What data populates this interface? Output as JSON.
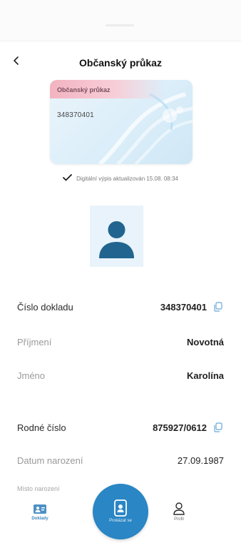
{
  "header": {
    "title": "Občanský průkaz",
    "back_icon": "chevron-left-icon"
  },
  "card": {
    "title": "Občanský průkaz",
    "number": "348370401"
  },
  "status": {
    "text": "Digitální výpis aktualizován 15.08. 08:34",
    "icon": "check-icon"
  },
  "photo": {
    "icon": "person-avatar-icon"
  },
  "fields": [
    {
      "label": "Číslo dokladu",
      "value": "348370401",
      "copy": true
    },
    {
      "label": "Příjmení",
      "value": "Novotná",
      "copy": false
    },
    {
      "label": "Jméno",
      "value": "Karolína",
      "copy": false
    },
    {
      "label": "Rodné číslo",
      "value": "875927/0612",
      "copy": true
    },
    {
      "label": "Datum narození",
      "value": "27.09.1987",
      "copy": false
    },
    {
      "label": "Místo narození",
      "value": "",
      "copy": false
    }
  ],
  "nav": {
    "doklady": "Doklady",
    "prokazat": "Prokázat se",
    "profil": "Profil"
  },
  "colors": {
    "accent": "#2a86c4",
    "nav_active": "#3f87bf",
    "card_band": "#f3b3c1"
  }
}
